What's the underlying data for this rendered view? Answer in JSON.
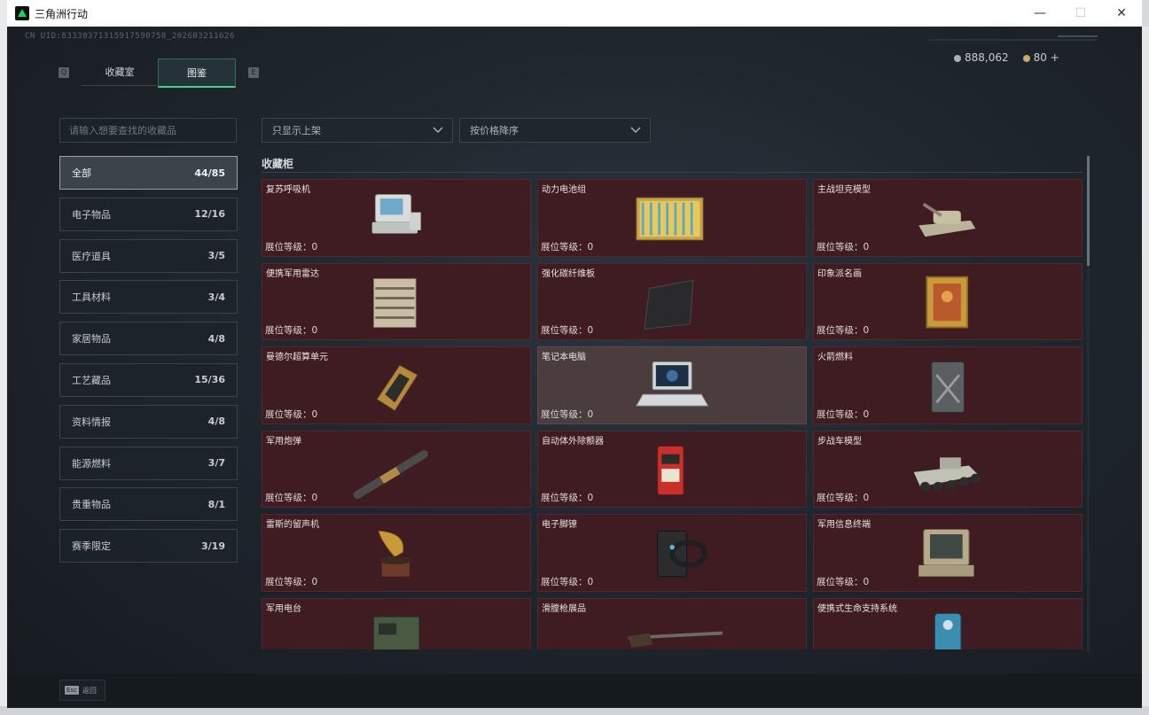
{
  "window": {
    "title": "三角洲行动"
  },
  "uid": "CN UID:83330371315917590758_202603211626",
  "currency": {
    "silver": "888,062",
    "gold": "80 +"
  },
  "tabs": [
    {
      "label": "收藏室",
      "active": false
    },
    {
      "label": "图鉴",
      "active": true
    }
  ],
  "tab_keys": {
    "left": "Q",
    "right": "E"
  },
  "search": {
    "placeholder": "请输入想要查找的收藏品"
  },
  "filters": {
    "listing": "只显示上架",
    "sort": "按价格降序"
  },
  "categories": [
    {
      "label": "全部",
      "count": "44/85",
      "active": true
    },
    {
      "label": "电子物品",
      "count": "12/16"
    },
    {
      "label": "医疗道具",
      "count": "3/5"
    },
    {
      "label": "工具材料",
      "count": "3/4"
    },
    {
      "label": "家居物品",
      "count": "4/8"
    },
    {
      "label": "工艺藏品",
      "count": "15/36"
    },
    {
      "label": "资料情报",
      "count": "4/8"
    },
    {
      "label": "能源燃料",
      "count": "3/7"
    },
    {
      "label": "贵重物品",
      "count": "8/1"
    },
    {
      "label": "赛季限定",
      "count": "3/19"
    }
  ],
  "section_title": "收藏柜",
  "items": [
    {
      "name": "复苏呼吸机",
      "level": "展位等级：0",
      "icon": "ventilator-icon"
    },
    {
      "name": "动力电池组",
      "level": "展位等级：0",
      "icon": "battery-pack-icon"
    },
    {
      "name": "主战坦克模型",
      "level": "展位等级：0",
      "icon": "tank-model-icon"
    },
    {
      "name": "便携军用雷达",
      "level": "展位等级：0",
      "icon": "radar-icon"
    },
    {
      "name": "强化碳纤维板",
      "level": "展位等级：0",
      "icon": "carbon-plate-icon"
    },
    {
      "name": "印象派名画",
      "level": "展位等级：0",
      "icon": "painting-icon"
    },
    {
      "name": "曼德尔超算单元",
      "level": "展位等级：0",
      "icon": "supercomputer-unit-icon"
    },
    {
      "name": "笔记本电脑",
      "level": "展位等级：0",
      "icon": "laptop-icon",
      "selected": true
    },
    {
      "name": "火箭燃料",
      "level": "展位等级：0",
      "icon": "fuel-can-icon"
    },
    {
      "name": "军用炮弹",
      "level": "展位等级：0",
      "icon": "shell-icon"
    },
    {
      "name": "自动体外除颤器",
      "level": "展位等级：0",
      "icon": "defibrillator-icon"
    },
    {
      "name": "步战车模型",
      "level": "展位等级：0",
      "icon": "ifv-model-icon"
    },
    {
      "name": "雷斯的留声机",
      "level": "展位等级：0",
      "icon": "gramophone-icon"
    },
    {
      "name": "电子脚镣",
      "level": "展位等级：0",
      "icon": "ankle-monitor-icon"
    },
    {
      "name": "军用信息终端",
      "level": "展位等级：0",
      "icon": "terminal-icon"
    },
    {
      "name": "军用电台",
      "level": "",
      "icon": "radio-icon"
    },
    {
      "name": "滑膛枪展品",
      "level": "",
      "icon": "musket-icon"
    },
    {
      "name": "便携式生命支持系统",
      "level": "",
      "icon": "life-support-icon"
    }
  ],
  "footer": {
    "esc_key": "Esc",
    "esc_label": "返回"
  },
  "colors": {
    "accent": "#3fd28b",
    "card_bg": "#3f1c22",
    "card_selected": "#4b3d3e"
  }
}
